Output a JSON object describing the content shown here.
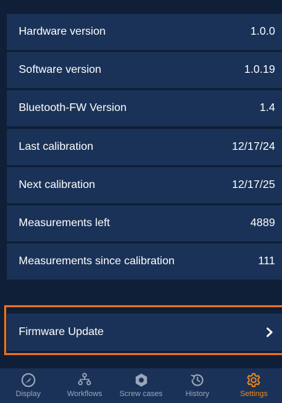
{
  "info_rows": [
    {
      "label": "Hardware version",
      "value": "1.0.0"
    },
    {
      "label": "Software version",
      "value": "1.0.19"
    },
    {
      "label": "Bluetooth-FW Version",
      "value": "1.4"
    },
    {
      "label": "Last calibration",
      "value": "12/17/24"
    },
    {
      "label": "Next calibration",
      "value": "12/17/25"
    },
    {
      "label": "Measurements left",
      "value": "4889"
    },
    {
      "label": "Measurements since calibration",
      "value": "111"
    }
  ],
  "firmware": {
    "label": "Firmware Update",
    "icon": "chevron-right-icon"
  },
  "nav": [
    {
      "label": "Display",
      "icon": "gauge-icon",
      "active": false
    },
    {
      "label": "Workflows",
      "icon": "workflow-icon",
      "active": false
    },
    {
      "label": "Screw cases",
      "icon": "hex-nut-icon",
      "active": false
    },
    {
      "label": "History",
      "icon": "history-icon",
      "active": false
    },
    {
      "label": "Settings",
      "icon": "gear-icon",
      "active": true
    }
  ],
  "colors": {
    "background": "#0f1f37",
    "row": "#1a3257",
    "accent": "#f08a1c",
    "highlight": "#e86d1c",
    "nav_inactive": "#9aa6ba"
  }
}
